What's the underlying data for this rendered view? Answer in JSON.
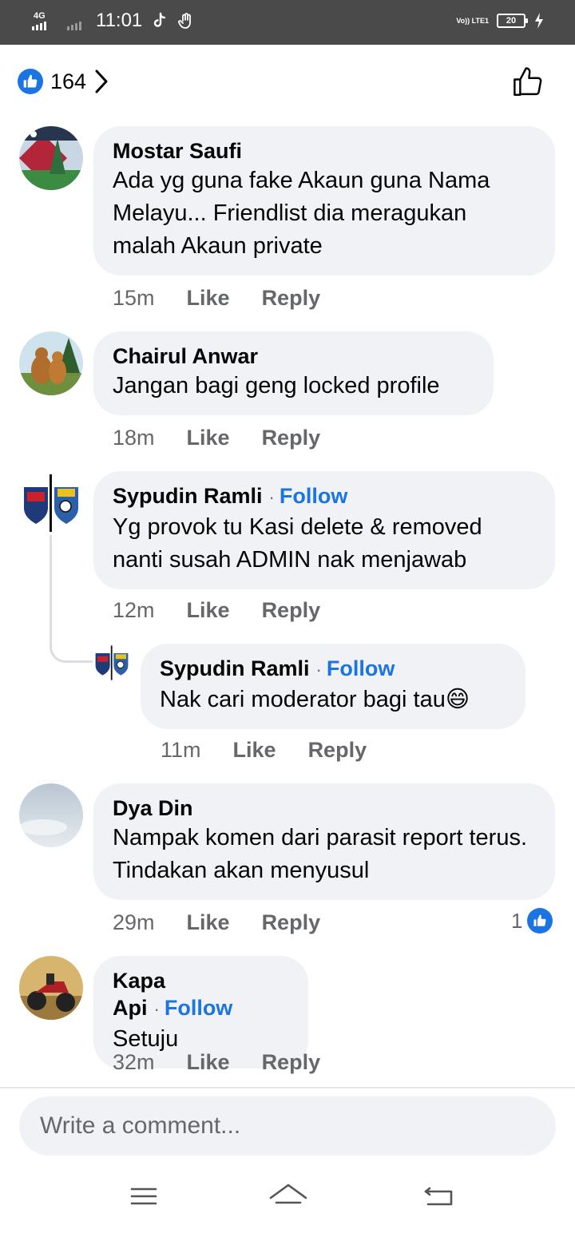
{
  "status_bar": {
    "network": "4G",
    "time": "11:01",
    "volte": "Vo)) LTE1",
    "battery": "20"
  },
  "reactions": {
    "count": "164",
    "icon": "like-badge-icon"
  },
  "comments": [
    {
      "author": "Mostar Saufi",
      "follow": "",
      "text": "Ada yg guna fake Akaun guna Nama Melayu... Friendlist dia meragukan malah Akaun private",
      "time": "15m",
      "like": "Like",
      "reply": "Reply"
    },
    {
      "author": "Chairul Anwar",
      "follow": "",
      "text": "Jangan bagi geng locked profile",
      "time": "18m",
      "like": "Like",
      "reply": "Reply"
    },
    {
      "author": "Sypudin Ramli",
      "follow": "Follow",
      "text": "Yg provok tu Kasi delete & removed nanti susah ADMIN nak menjawab",
      "time": "12m",
      "like": "Like",
      "reply": "Reply"
    },
    {
      "author": "Sypudin Ramli",
      "follow": "Follow",
      "text": "Nak cari moderator bagi tau😄",
      "time": "11m",
      "like": "Like",
      "reply": "Reply"
    },
    {
      "author": "Dya Din",
      "follow": "",
      "text": "Nampak komen dari parasit report terus. Tindakan akan menyusul",
      "time": "29m",
      "like": "Like",
      "reply": "Reply",
      "reaction_count": "1"
    },
    {
      "author": "Kapa Api",
      "follow": "Follow",
      "text": "Setuju",
      "time": "32m",
      "like": "Like",
      "reply": "Reply"
    }
  ],
  "composer": {
    "placeholder": "Write a comment..."
  },
  "colors": {
    "accent": "#1b74e4",
    "bubble": "#f0f2f5",
    "meta": "#65676b",
    "status_bar": "#4a4a4a"
  }
}
